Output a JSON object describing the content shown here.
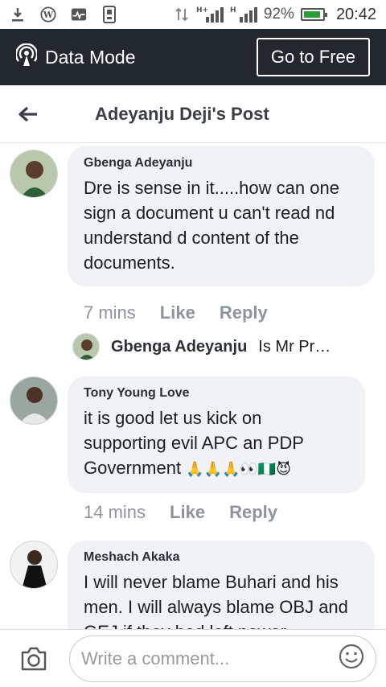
{
  "status_bar": {
    "battery": "92%",
    "time": "20:42",
    "network_1": "H+",
    "network_2": "H"
  },
  "data_bar": {
    "label": "Data Mode",
    "button": "Go to Free"
  },
  "header": {
    "title": "Adeyanju Deji's Post"
  },
  "comments": [
    {
      "name": "Gbenga Adeyanju",
      "text": "Dre is sense in it.....how can one sign a document u can't read nd understand d content of the documents.",
      "time": "7 mins",
      "like": "Like",
      "reply": "Reply"
    },
    {
      "name": "Tony Young Love",
      "text": "it is good let us kick on supporting evil APC an PDP Government",
      "emoji": "🙏🙏🙏👀🇳🇬😈",
      "time": "14 mins",
      "like": "Like",
      "reply": "Reply"
    },
    {
      "name": "Meshach Akaka",
      "text": "I will never blame Buhari and his men. I will always blame OBJ and GEJ if they had left power..."
    }
  ],
  "reply_preview": {
    "name": "Gbenga Adeyanju",
    "text": "Is Mr Pr…"
  },
  "composer": {
    "placeholder": "Write a comment..."
  }
}
